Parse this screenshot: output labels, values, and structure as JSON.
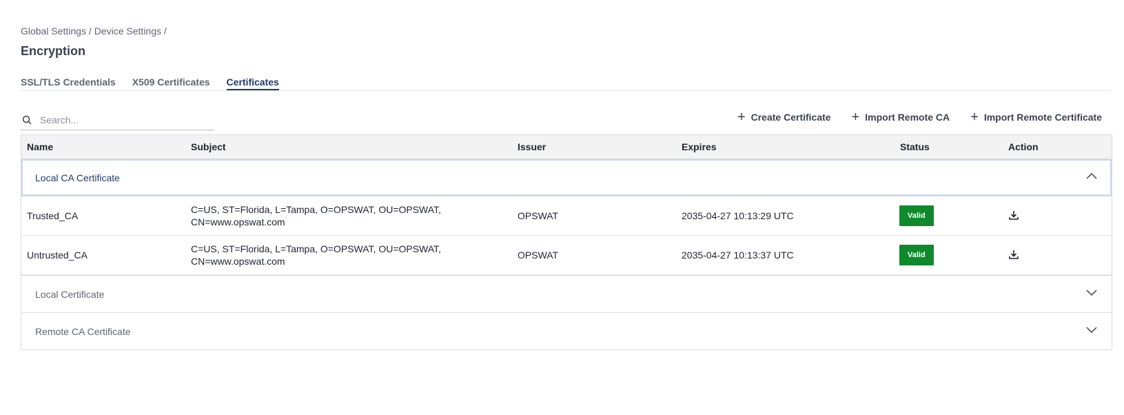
{
  "breadcrumb": {
    "item1": "Global Settings /",
    "item2": "Device Settings /"
  },
  "page": {
    "title": "Encryption"
  },
  "tabs": [
    {
      "label": "SSL/TLS Credentials"
    },
    {
      "label": "X509 Certificates"
    },
    {
      "label": "Certificates"
    }
  ],
  "active_tab": "Certificates",
  "search": {
    "placeholder": "Search...",
    "value": ""
  },
  "actions": {
    "create_certificate": "Create Certificate",
    "import_remote_ca": "Import Remote CA",
    "import_remote_certificate": "Import Remote Certificate"
  },
  "table": {
    "headers": {
      "name": "Name",
      "subject": "Subject",
      "issuer": "Issuer",
      "expires": "Expires",
      "status": "Status",
      "action": "Action"
    },
    "groups": [
      {
        "label": "Local CA Certificate",
        "expanded": true,
        "rows": [
          {
            "name": "Trusted_CA",
            "subject_line1": "C=US, ST=Florida, L=Tampa, O=OPSWAT, OU=OPSWAT,",
            "subject_line2": "CN=www.opswat.com",
            "issuer": "OPSWAT",
            "expires": "2035-04-27 10:13:29 UTC",
            "status": "Valid"
          },
          {
            "name": "Untrusted_CA",
            "subject_line1": "C=US, ST=Florida, L=Tampa, O=OPSWAT, OU=OPSWAT,",
            "subject_line2": "CN=www.opswat.com",
            "issuer": "OPSWAT",
            "expires": "2035-04-27 10:13:37 UTC",
            "status": "Valid"
          }
        ]
      },
      {
        "label": "Local Certificate",
        "expanded": false
      },
      {
        "label": "Remote CA Certificate",
        "expanded": false
      }
    ]
  },
  "colors": {
    "valid_badge": "#0e8a2c",
    "accent": "#1d3a6b"
  },
  "icons": {
    "search": "search-icon",
    "plus": "plus-icon",
    "chevron_up": "chevron-up-icon",
    "chevron_down": "chevron-down-icon",
    "download": "download-icon"
  }
}
